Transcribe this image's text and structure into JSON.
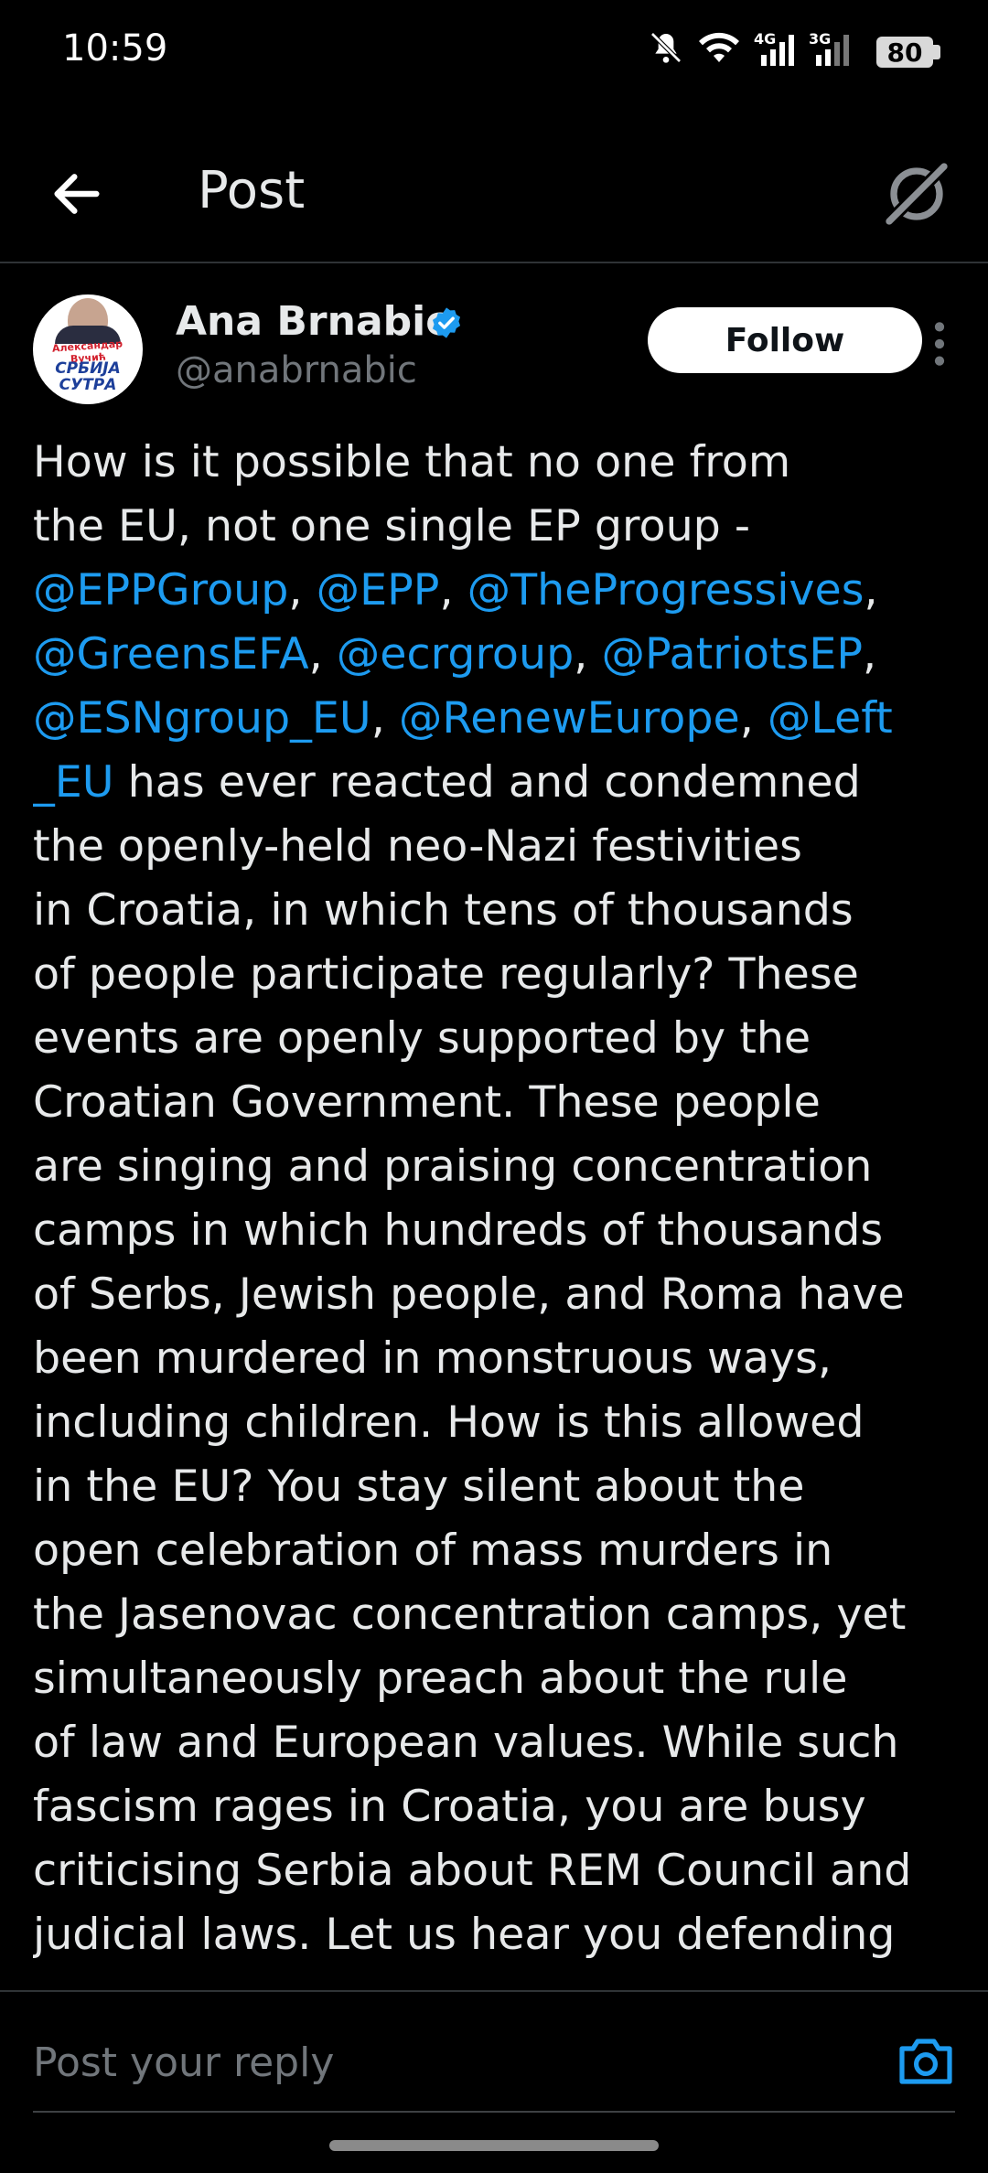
{
  "status_bar": {
    "time": "10:59",
    "battery": "80",
    "network_1": "4G",
    "network_2": "3G"
  },
  "header": {
    "title": "Post",
    "back_icon": "arrow-left-icon",
    "grok_icon": "grok-icon"
  },
  "author": {
    "name": "Ana Brnabic",
    "handle": "@anabrnabic",
    "verified": true,
    "follow_label": "Follow",
    "avatar_text_top": "Александар Вучић",
    "avatar_text_bottom": "СРБИЈА СУТРА"
  },
  "tweet": {
    "lines": [
      [
        {
          "t": "How is it possible that no one from",
          "m": false
        }
      ],
      [
        {
          "t": "the EU, not one single EP group -",
          "m": false
        }
      ],
      [
        {
          "t": "@EPPGroup",
          "m": true
        },
        {
          "t": ", ",
          "m": false
        },
        {
          "t": "@EPP",
          "m": true
        },
        {
          "t": ", ",
          "m": false
        },
        {
          "t": "@TheProgressives",
          "m": true
        },
        {
          "t": ",",
          "m": false
        }
      ],
      [
        {
          "t": "@GreensEFA",
          "m": true
        },
        {
          "t": ", ",
          "m": false
        },
        {
          "t": "@ecrgroup",
          "m": true
        },
        {
          "t": ", ",
          "m": false
        },
        {
          "t": "@PatriotsEP",
          "m": true
        },
        {
          "t": ",",
          "m": false
        }
      ],
      [
        {
          "t": "@ESNgroup_EU",
          "m": true
        },
        {
          "t": ", ",
          "m": false
        },
        {
          "t": "@RenewEurope",
          "m": true
        },
        {
          "t": ", ",
          "m": false
        },
        {
          "t": "@Left",
          "m": true
        }
      ],
      [
        {
          "t": "_EU",
          "m": true
        },
        {
          "t": " has ever reacted and condemned",
          "m": false
        }
      ],
      [
        {
          "t": "the openly-held neo-Nazi festivities",
          "m": false
        }
      ],
      [
        {
          "t": "in Croatia, in which tens of thousands",
          "m": false
        }
      ],
      [
        {
          "t": "of people participate regularly? These",
          "m": false
        }
      ],
      [
        {
          "t": "events are openly supported by the",
          "m": false
        }
      ],
      [
        {
          "t": "Croatian Government. These people",
          "m": false
        }
      ],
      [
        {
          "t": "are singing and praising concentration",
          "m": false
        }
      ],
      [
        {
          "t": "camps in which hundreds of thousands",
          "m": false
        }
      ],
      [
        {
          "t": "of Serbs, Jewish people, and Roma have",
          "m": false
        }
      ],
      [
        {
          "t": "been murdered in monstruous ways,",
          "m": false
        }
      ],
      [
        {
          "t": "including children. How is this allowed",
          "m": false
        }
      ],
      [
        {
          "t": "in the EU? You stay silent about the",
          "m": false
        }
      ],
      [
        {
          "t": "open celebration of mass murders in",
          "m": false
        }
      ],
      [
        {
          "t": "the Jasenovac concentration camps, yet",
          "m": false
        }
      ],
      [
        {
          "t": "simultaneously preach about the rule",
          "m": false
        }
      ],
      [
        {
          "t": "of law and European values. While such",
          "m": false
        }
      ],
      [
        {
          "t": "fascism rages in Croatia, you are busy",
          "m": false
        }
      ],
      [
        {
          "t": "criticising Serbia about REM Council and",
          "m": false
        }
      ],
      [
        {
          "t": "judicial laws. Let us hear you defending",
          "m": false
        }
      ]
    ]
  },
  "reply": {
    "placeholder": "Post your reply",
    "camera_icon": "camera-icon"
  },
  "colors": {
    "background": "#000000",
    "text": "#e7e9ea",
    "muted": "#71767b",
    "accent": "#1d9bf0"
  }
}
